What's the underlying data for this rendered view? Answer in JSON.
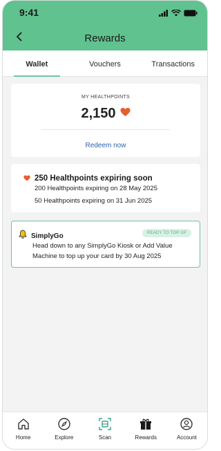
{
  "status_bar": {
    "time": "9:41"
  },
  "header": {
    "title": "Rewards"
  },
  "tabs": [
    {
      "label": "Wallet",
      "active": true
    },
    {
      "label": "Vouchers",
      "active": false
    },
    {
      "label": "Transactions",
      "active": false
    }
  ],
  "healthpoints": {
    "label": "MY HEALTHPOINTS",
    "value": "2,150",
    "redeem_label": "Redeem now"
  },
  "expiring": {
    "title": "250 Healthpoints expiring soon",
    "lines": [
      "200 Healthpoints expiring on 28 May 2025",
      "50 Healthpoints expiring on 31 Jun 2025"
    ]
  },
  "simplygo": {
    "title": "SimplyGo",
    "badge": "READY TO TOP UP",
    "text": "Head down to any SimplyGo Kiosk or Add Value Machine to top up your card by 30 Aug 2025"
  },
  "nav": [
    {
      "label": "Home",
      "icon": "home-icon"
    },
    {
      "label": "Explore",
      "icon": "compass-icon"
    },
    {
      "label": "Scan",
      "icon": "scan-icon"
    },
    {
      "label": "Rewards",
      "icon": "gift-icon"
    },
    {
      "label": "Account",
      "icon": "user-icon"
    }
  ],
  "colors": {
    "header_green": "#5fc28f",
    "accent_green": "#6cc6a2",
    "heart_orange": "#e3612f",
    "link_blue": "#2e63a6"
  }
}
